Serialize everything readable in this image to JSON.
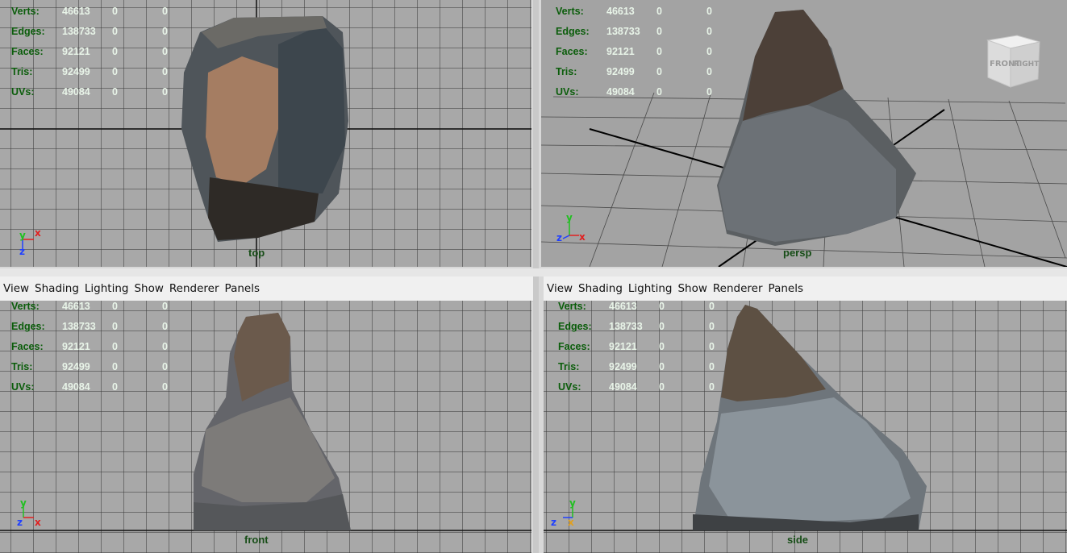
{
  "menu": [
    "View",
    "Shading",
    "Lighting",
    "Show",
    "Renderer",
    "Panels"
  ],
  "stats": {
    "rows": [
      {
        "label": "Verts:",
        "value": "46613",
        "z1": "0",
        "z2": "0"
      },
      {
        "label": "Edges:",
        "value": "138733",
        "z1": "0",
        "z2": "0"
      },
      {
        "label": "Faces:",
        "value": "92121",
        "z1": "0",
        "z2": "0"
      },
      {
        "label": "Tris:",
        "value": "92499",
        "z1": "0",
        "z2": "0"
      },
      {
        "label": "UVs:",
        "value": "49084",
        "z1": "0",
        "z2": "0"
      }
    ]
  },
  "viewports": {
    "top": {
      "label": "top"
    },
    "persp": {
      "label": "persp"
    },
    "front": {
      "label": "front"
    },
    "side": {
      "label": "side"
    }
  },
  "axes": {
    "x": "x",
    "y": "y",
    "z": "z"
  },
  "viewcube": {
    "front": "FRONT",
    "right": "RIGHT"
  },
  "colors": {
    "viewport_bg": "#a8a8a8",
    "grid": "#555555",
    "stat_label": "#0b5d0b",
    "axis_x": "#e02020",
    "axis_y": "#20c020",
    "axis_z": "#2040ff"
  }
}
